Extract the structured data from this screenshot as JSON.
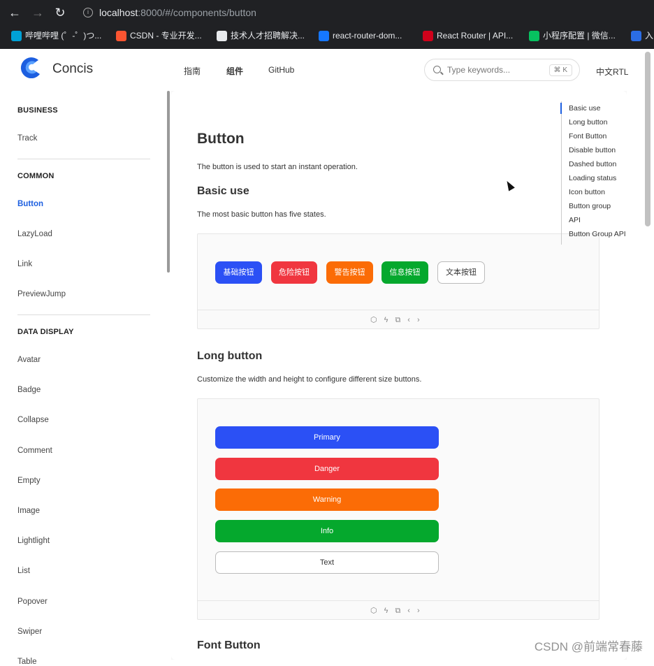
{
  "browser": {
    "url_host": "localhost",
    "url_path": ":8000/#/components/button",
    "bookmarks": [
      {
        "label": "哔哩哔哩 (゜-゜)つ...",
        "color": "#00a1d6"
      },
      {
        "label": "CSDN - 专业开发...",
        "color": "#fc5531"
      },
      {
        "label": "技术人才招聘解决...",
        "color": "#e8eaed"
      },
      {
        "label": "react-router-dom...",
        "color": "#1677ff"
      },
      {
        "label": "React Router | API...",
        "color": "#d0021b"
      },
      {
        "label": "小程序配置 | 微信...",
        "color": "#07c160"
      },
      {
        "label": "入",
        "color": "#2b6de5"
      }
    ]
  },
  "header": {
    "brand": "Concis",
    "nav": [
      "指南",
      "组件",
      "GitHub"
    ],
    "search_placeholder": "Type keywords...",
    "search_shortcut": "⌘ K",
    "lang": "中文RTL"
  },
  "sidebar": {
    "sections": [
      {
        "title": "BUSINESS",
        "items": [
          "Track"
        ]
      },
      {
        "title": "COMMON",
        "items": [
          "Button",
          "LazyLoad",
          "Link",
          "PreviewJump"
        ]
      },
      {
        "title": "DATA DISPLAY",
        "items": [
          "Avatar",
          "Badge",
          "Collapse",
          "Comment",
          "Empty",
          "Image",
          "Lightlight",
          "List",
          "Popover",
          "Swiper",
          "Table"
        ]
      }
    ],
    "active": "Button"
  },
  "page": {
    "title": "Button",
    "intro": "The button is used to start an instant operation.",
    "basic_title": "Basic use",
    "basic_desc": "The most basic button has five states.",
    "basic_buttons": [
      {
        "label": "基础按钮",
        "color": "#2b50f5"
      },
      {
        "label": "危险按钮",
        "color": "#f0363f"
      },
      {
        "label": "警告按钮",
        "color": "#fb6c06"
      },
      {
        "label": "信息按钮",
        "color": "#05a82d"
      },
      {
        "label": "文本按钮",
        "color": "#ffffff"
      }
    ],
    "long_title": "Long button",
    "long_desc": "Customize the width and height to configure different size buttons.",
    "long_buttons": [
      {
        "label": "Primary",
        "color": "#2b50f5"
      },
      {
        "label": "Danger",
        "color": "#f0363f"
      },
      {
        "label": "Warning",
        "color": "#fb6c06"
      },
      {
        "label": "Info",
        "color": "#05a82d"
      },
      {
        "label": "Text",
        "color": "#ffffff"
      }
    ],
    "font_title": "Font Button"
  },
  "toc": [
    "Basic use",
    "Long button",
    "Font Button",
    "Disable button",
    "Dashed button",
    "Loading status",
    "Icon button",
    "Button group",
    "API",
    "Button Group API"
  ],
  "watermark": "CSDN @前端常春藤"
}
